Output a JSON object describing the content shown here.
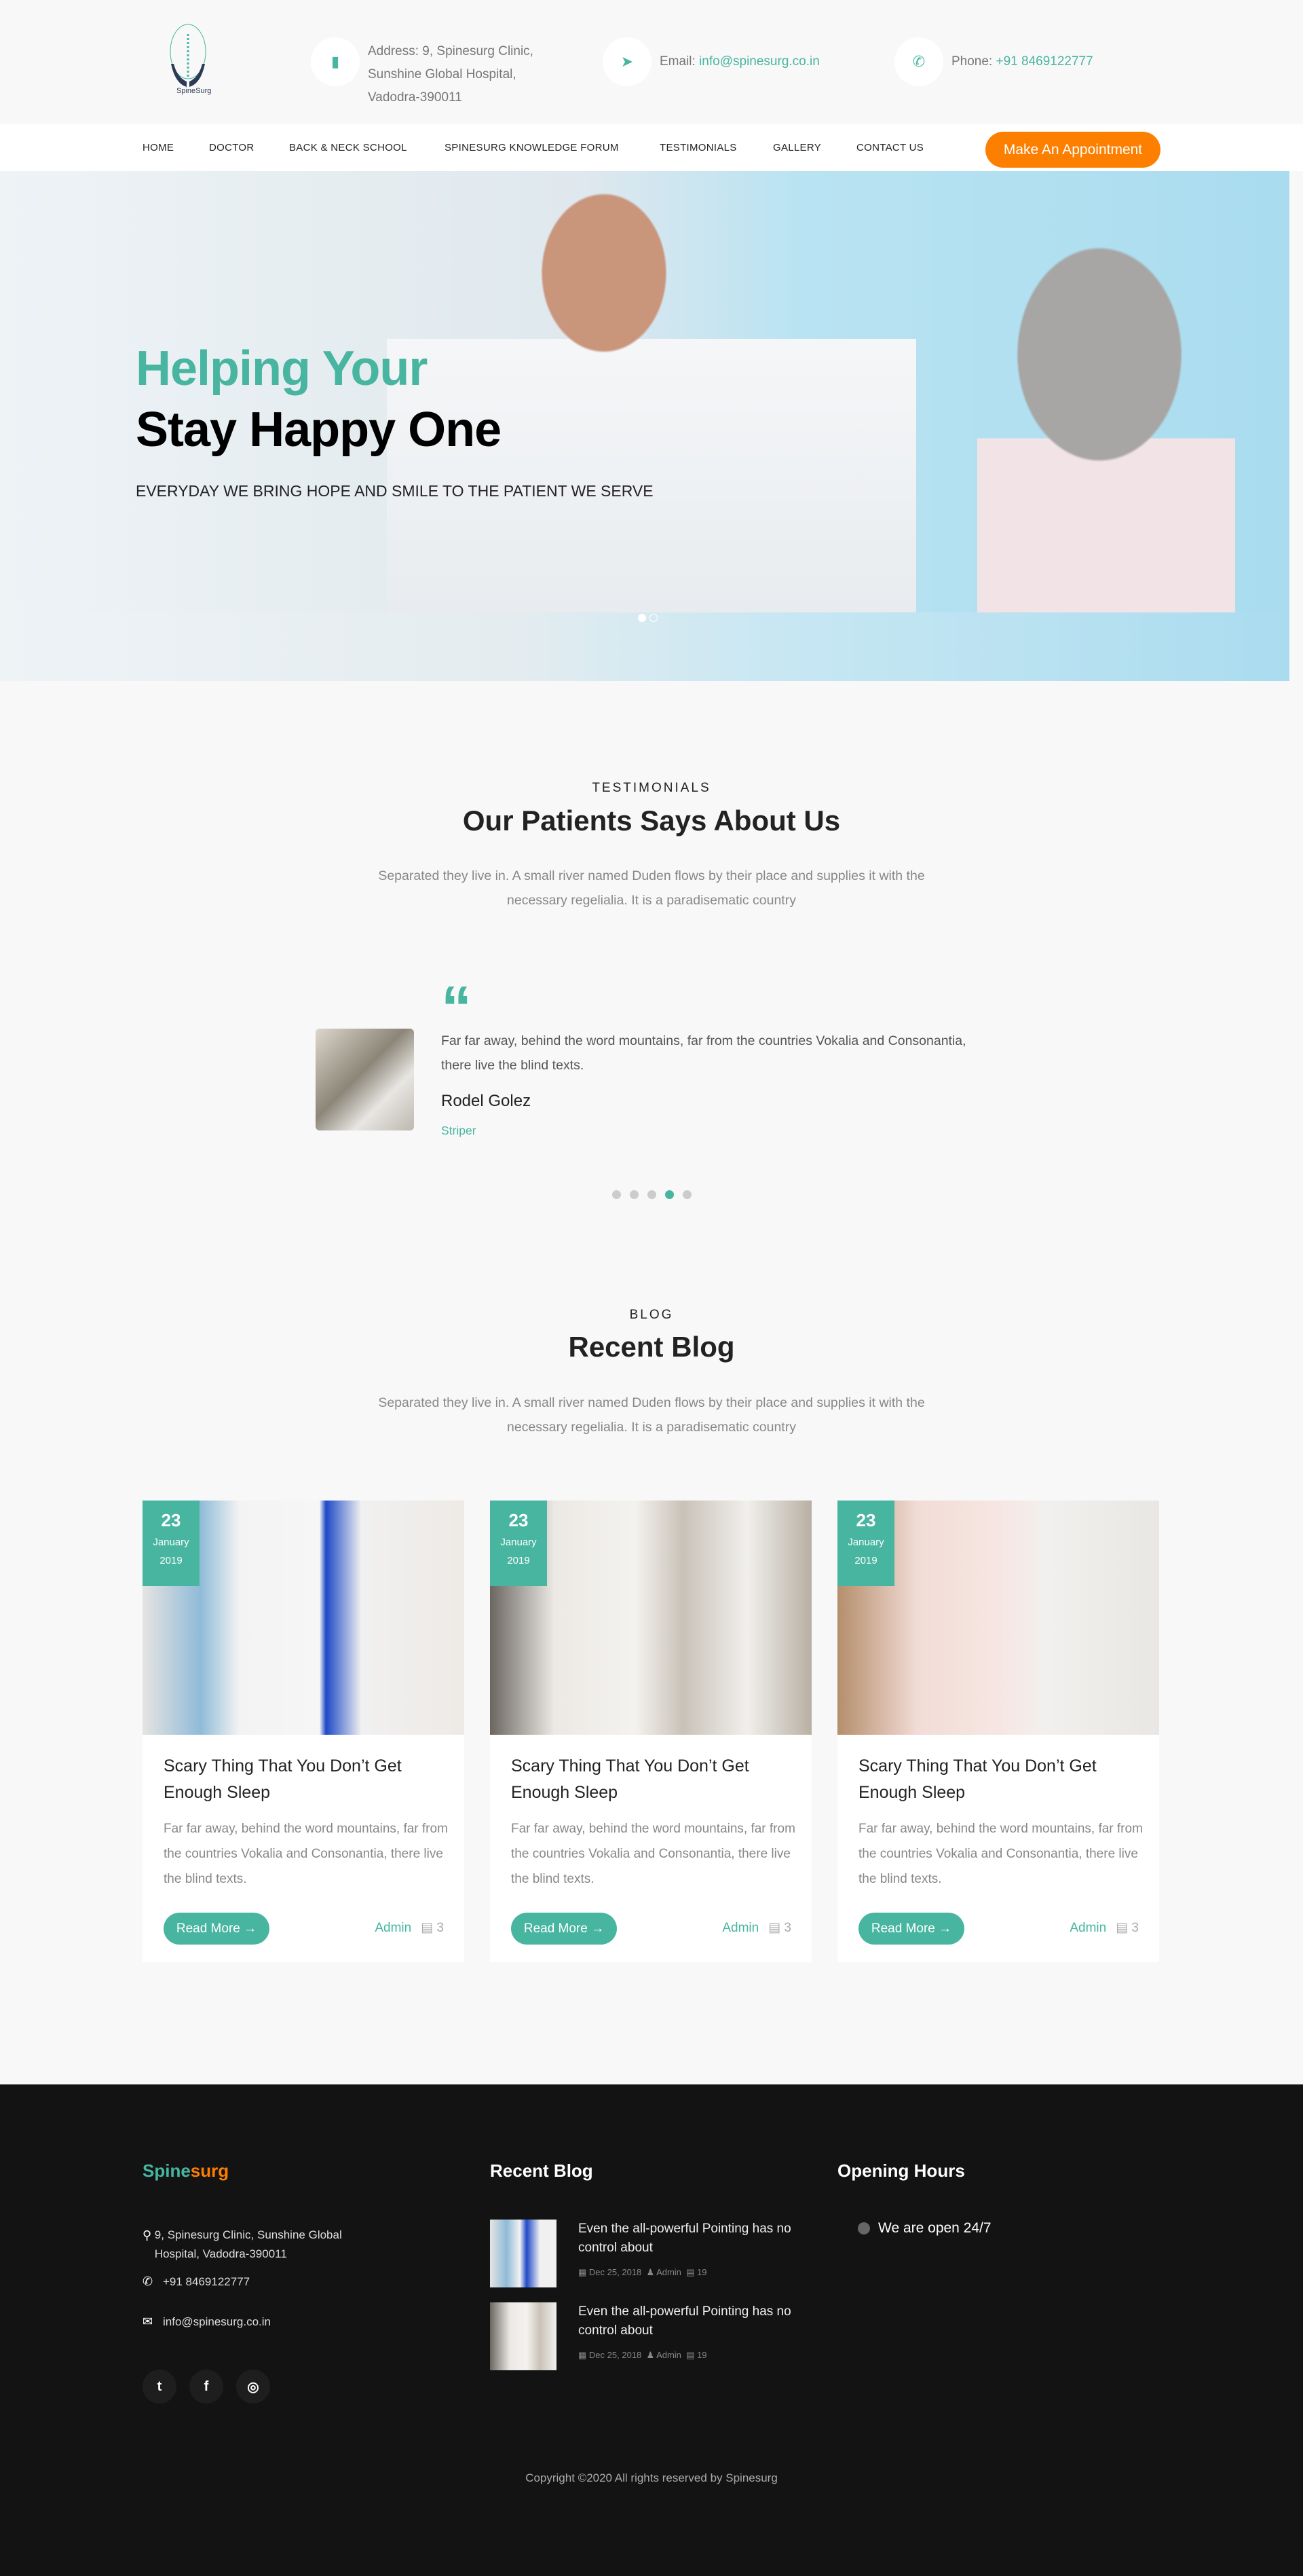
{
  "header": {
    "logo_text": "SpineSurg",
    "address_label": "Address:",
    "address_lines": [
      "9, Spinesurg Clinic,",
      "Sunshine Global Hospital,",
      "Vadodra-390011"
    ],
    "email_label": "Email:",
    "email": "info@spinesurg.co.in",
    "phone_label": "Phone:",
    "phone": "+91 8469122777"
  },
  "nav": {
    "items": [
      "HOME",
      "DOCTOR",
      "BACK & NECK SCHOOL",
      "SPINESURG KNOWLEDGE FORUM",
      "TESTIMONIALS",
      "GALLERY",
      "CONTACT US"
    ],
    "cta": "Make An Appointment"
  },
  "hero": {
    "line1": "Helping Your",
    "line2": "Stay Happy One",
    "subtitle": "EVERYDAY WE BRING HOPE AND SMILE TO THE PATIENT WE SERVE"
  },
  "testimonials": {
    "eyebrow": "TESTIMONIALS",
    "title": "Our Patients Says About Us",
    "intro_lines": [
      "Separated they live in. A small river named Duden flows by their place and supplies it with the",
      "necessary regelialia. It is a paradisematic country"
    ],
    "quote": "Far far away, behind the word mountains, far from the countries Vokalia and Consonantia, there live the blind texts.",
    "name": "Rodel Golez",
    "role": "Striper",
    "active_slide": 4,
    "slide_count": 5
  },
  "blog": {
    "eyebrow": "BLOG",
    "title": "Recent Blog",
    "intro_lines": [
      "Separated they live in. A small river named Duden flows by their place and supplies it with the",
      "necessary regelialia. It is a paradisematic country"
    ],
    "posts": [
      {
        "day": "23",
        "month": "January",
        "year": "2019",
        "title": "Scary Thing That You Don’t Get Enough Sleep",
        "excerpt": "Far far away, behind the word mountains, far from the countries Vokalia and Consonantia, there live the blind texts.",
        "button": "Read More →",
        "author": "Admin",
        "comments": "3"
      },
      {
        "day": "23",
        "month": "January",
        "year": "2019",
        "title": "Scary Thing That You Don’t Get Enough Sleep",
        "excerpt": "Far far away, behind the word mountains, far from the countries Vokalia and Consonantia, there live the blind texts.",
        "button": "Read More →",
        "author": "Admin",
        "comments": "3"
      },
      {
        "day": "23",
        "month": "January",
        "year": "2019",
        "title": "Scary Thing That You Don’t Get Enough Sleep",
        "excerpt": "Far far away, behind the word mountains, far from the countries Vokalia and Consonantia, there live the blind texts.",
        "button": "Read More →",
        "author": "Admin",
        "comments": "3"
      }
    ]
  },
  "footer": {
    "brand_a": "Spine",
    "brand_b": "surg",
    "address": "9, Spinesurg Clinic, Sunshine Global Hospital, Vadodra-390011",
    "phone": "+91 8469122777",
    "email": "info@spinesurg.co.in",
    "recent_blog_title": "Recent Blog",
    "recent_posts": [
      {
        "title": "Even the all-powerful Pointing has no control about",
        "date": "Dec 25, 2018",
        "author": "Admin",
        "comments": "19"
      },
      {
        "title": "Even the all-powerful Pointing has no control about",
        "date": "Dec 25, 2018",
        "author": "Admin",
        "comments": "19"
      }
    ],
    "hours_title": "Opening Hours",
    "hours": "We are open 24/7",
    "copyright": "Copyright ©2020 All rights reserved by Spinesurg"
  },
  "colors": {
    "accent": "#47b5a0",
    "cta": "#fd7f00",
    "footer_bg": "#131313"
  }
}
